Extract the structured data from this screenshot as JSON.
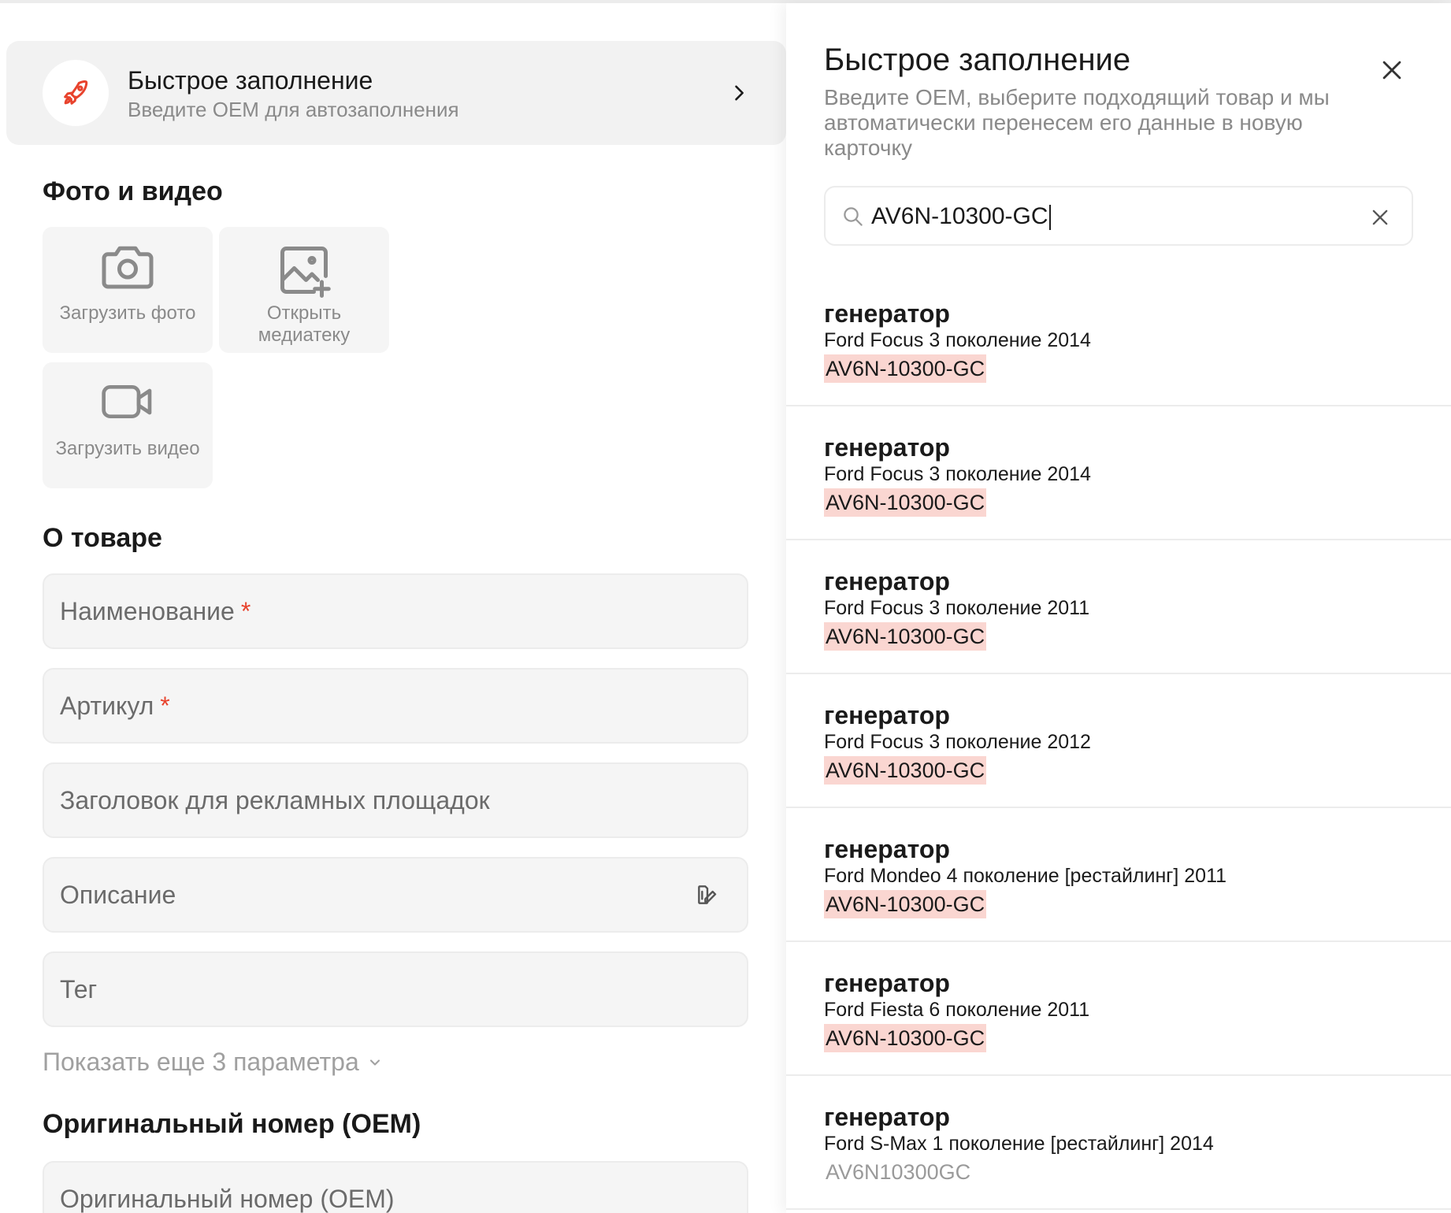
{
  "quick_fill_card": {
    "title": "Быстрое заполнение",
    "subtitle": "Введите OEM для автозаполнения",
    "icon": "rocket-icon"
  },
  "media": {
    "title": "Фото и видео",
    "tiles": [
      {
        "label": "Загрузить фото",
        "icon": "camera-icon"
      },
      {
        "label": "Открыть медиатеку",
        "icon": "image-add-icon"
      },
      {
        "label": "Загрузить видео",
        "icon": "video-camera-icon"
      }
    ]
  },
  "about": {
    "title": "О товаре",
    "fields": [
      {
        "placeholder": "Наименование",
        "required": "*"
      },
      {
        "placeholder": "Артикул",
        "required": "*"
      },
      {
        "placeholder": "Заголовок для рекламных площадок"
      },
      {
        "placeholder": "Описание"
      },
      {
        "placeholder": "Тег"
      }
    ],
    "show_more": "Показать еще 3 параметра"
  },
  "oem_section": {
    "title": "Оригинальный номер (OEM)",
    "field_placeholder": "Оригинальный номер (OEM)"
  },
  "panel": {
    "title": "Быстрое заполнение",
    "description": "Введите OEM, выберите подходящий товар и мы автоматически перенесем его данные в новую карточку",
    "search_value": "AV6N-10300-GC",
    "results": [
      {
        "name": "генератор",
        "car": "Ford Focus 3 поколение 2014",
        "oem": "AV6N-10300-GC"
      },
      {
        "name": "генератор",
        "car": "Ford Focus 3 поколение 2014",
        "oem": "AV6N-10300-GC"
      },
      {
        "name": "генератор",
        "car": "Ford Focus 3 поколение 2011",
        "oem": "AV6N-10300-GC"
      },
      {
        "name": "генератор",
        "car": "Ford Focus 3 поколение 2012",
        "oem": "AV6N-10300-GC"
      },
      {
        "name": "генератор",
        "car": "Ford Mondeo 4 поколение [рестайлинг] 2011",
        "oem": "AV6N-10300-GC"
      },
      {
        "name": "генератор",
        "car": "Ford Fiesta 6 поколение 2011",
        "oem": "AV6N-10300-GC"
      },
      {
        "name": "генератор",
        "car": "Ford S-Max 1 поколение [рестайлинг] 2014",
        "oem": "AV6N10300GC"
      }
    ]
  },
  "colors": {
    "accent": "#e8432d",
    "highlight": "#fad6d1",
    "muted_text": "#8a8a8a",
    "field_bg": "#f5f5f5"
  }
}
